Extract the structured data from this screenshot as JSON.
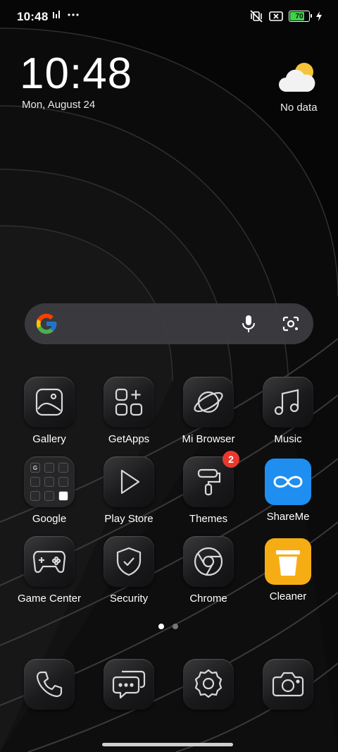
{
  "status_bar": {
    "time": "10:48",
    "battery_level": "70",
    "battery_fill_fraction": 0.7,
    "battery_color": "#3fd24b"
  },
  "clock_widget": {
    "time": "10:48",
    "date": "Mon, August 24",
    "weather_text": "No data"
  },
  "search": {
    "mic_icon": "mic-icon",
    "lens_icon": "camera-lens-icon"
  },
  "apps": [
    {
      "label": "Gallery",
      "icon": "gallery-icon"
    },
    {
      "label": "GetApps",
      "icon": "getapps-icon"
    },
    {
      "label": "Mi Browser",
      "icon": "browser-icon"
    },
    {
      "label": "Music",
      "icon": "music-icon"
    },
    {
      "label": "Google",
      "icon": "google-folder-icon"
    },
    {
      "label": "Play Store",
      "icon": "play-icon"
    },
    {
      "label": "Themes",
      "icon": "themes-icon",
      "badge": "2"
    },
    {
      "label": "ShareMe",
      "icon": "shareme-icon"
    },
    {
      "label": "Game Center",
      "icon": "gamepad-icon"
    },
    {
      "label": "Security",
      "icon": "shield-icon"
    },
    {
      "label": "Chrome",
      "icon": "chrome-icon"
    },
    {
      "label": "Cleaner",
      "icon": "trash-icon"
    }
  ],
  "google_folder_letter": "G",
  "dock": [
    {
      "name": "phone",
      "icon": "phone-icon"
    },
    {
      "name": "messages",
      "icon": "messages-icon"
    },
    {
      "name": "settings",
      "icon": "settings-icon"
    },
    {
      "name": "camera",
      "icon": "camera-icon"
    }
  ],
  "page_indicator": {
    "pages": 2,
    "current": 1
  },
  "colors": {
    "badge": "#e8392f",
    "shareme": "#1e8ef0",
    "cleaner": "#f6ad14"
  }
}
